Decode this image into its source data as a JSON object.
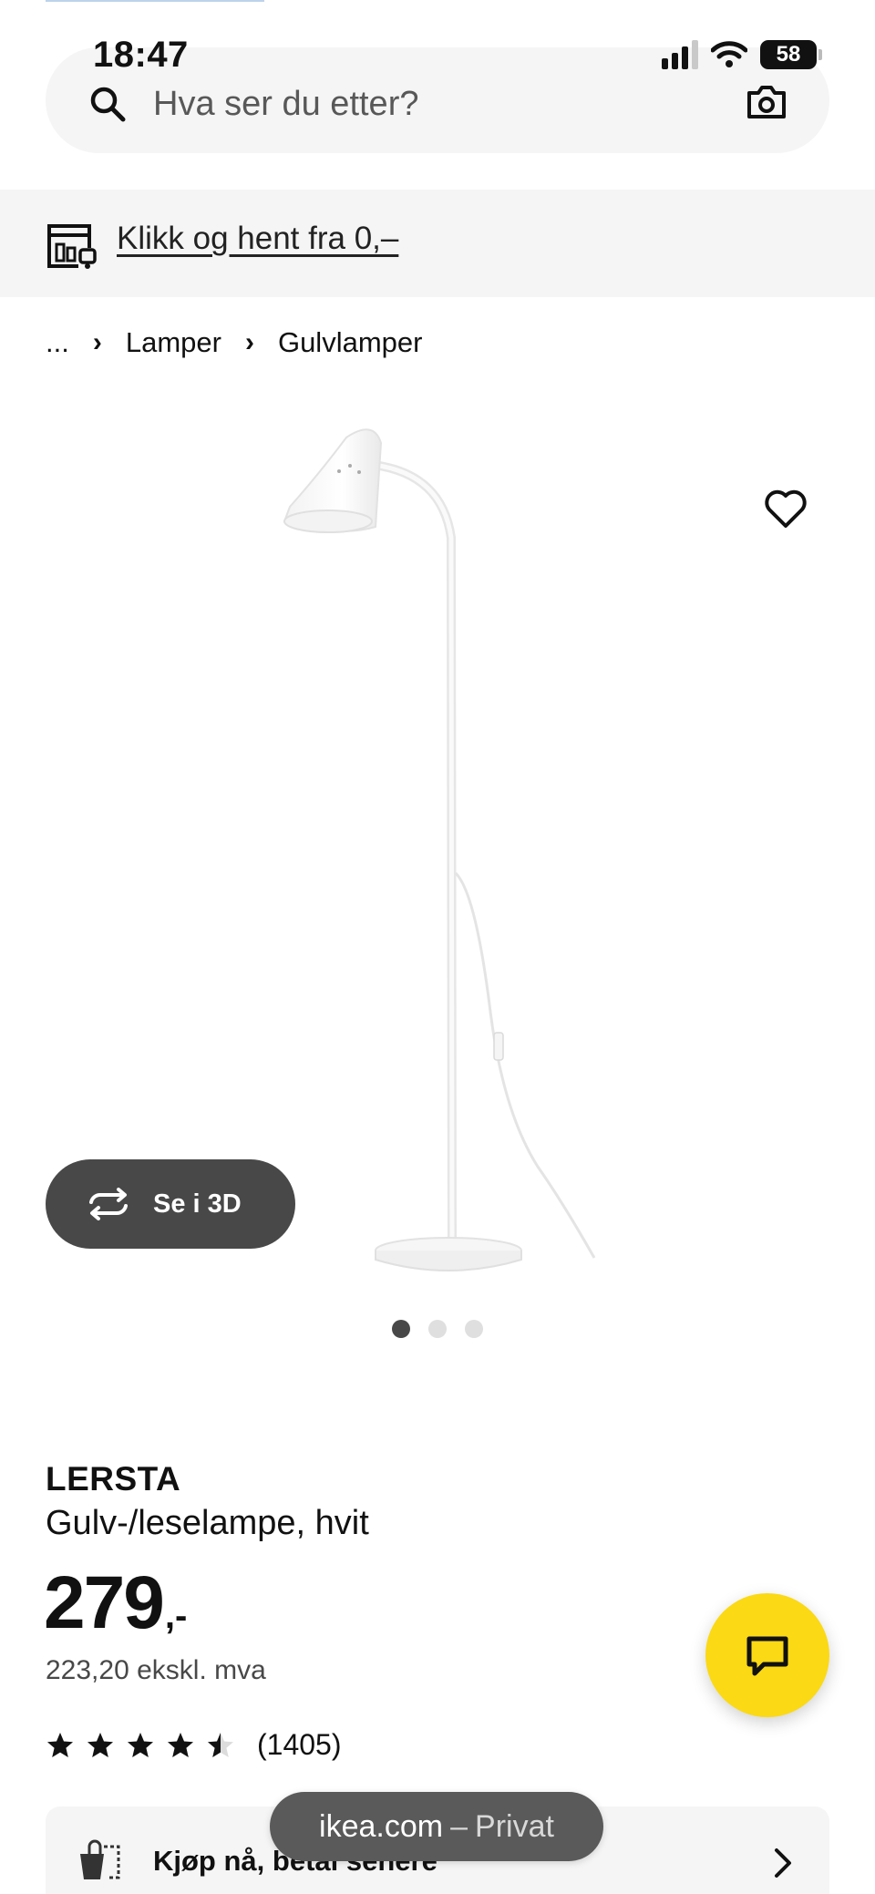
{
  "status_bar": {
    "time": "18:47",
    "battery_level": "58",
    "signal_bars_active": 3,
    "signal_bars_total": 4
  },
  "search": {
    "placeholder": "Hva ser du etter?",
    "value": ""
  },
  "click_collect": {
    "label": "Klikk og hent fra 0,–"
  },
  "breadcrumb": {
    "items": [
      "...",
      "Lamper",
      "Gulvlamper"
    ]
  },
  "product": {
    "view_3d_label": "Se i 3D",
    "carousel_total": 3,
    "carousel_active_index": 0,
    "name": "LERSTA",
    "description": "Gulv-/leselampe, hvit",
    "price_integer": "279",
    "price_suffix": ",-",
    "price_ex_vat": "223,20 ekskl. mva",
    "rating_value": 4.5,
    "rating_max": 5,
    "rating_count": "(1405)"
  },
  "pay_later": {
    "label": "Kjøp nå, betal senere"
  },
  "browser": {
    "domain": "ikea.com",
    "separator": "–",
    "mode": "Privat"
  },
  "colors": {
    "accent_yellow": "#fbd914",
    "dark_gray": "#484848",
    "light_gray": "#f5f5f5"
  },
  "icons": [
    "search-icon",
    "camera-icon",
    "store-icon",
    "heart-icon",
    "rotate-icon",
    "star-icon",
    "chat-icon",
    "pay-later-icon",
    "chevron-right-icon",
    "wifi-icon",
    "signal-icon",
    "battery-icon"
  ]
}
